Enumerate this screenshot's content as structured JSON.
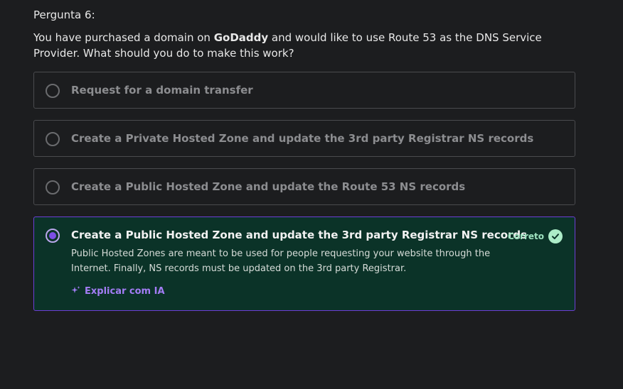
{
  "question": {
    "label": "Pergunta 6:",
    "text_before": "You have purchased a domain on ",
    "text_bold": "GoDaddy",
    "text_after": " and would like to use Route 53 as the DNS Service Provider. What should you do to make this work?"
  },
  "options": [
    {
      "label": "Request for a domain transfer",
      "selected": false
    },
    {
      "label": "Create a Private Hosted Zone and update the 3rd party Registrar NS records",
      "selected": false
    },
    {
      "label": "Create a Public Hosted Zone and update the Route 53 NS records",
      "selected": false
    },
    {
      "label": "Create a Public Hosted Zone and update the 3rd party Registrar NS records",
      "selected": true
    }
  ],
  "feedback": {
    "status": "Correto",
    "explanation": "Public Hosted Zones are meant to be used for people requesting your website through the Internet. Finally, NS records must be updated on the 3rd party Registrar.",
    "ai_link": "Explicar com IA"
  },
  "colors": {
    "background": "#1c1d1f",
    "correct_background": "#0b3328",
    "selected_border": "#6c3fd6",
    "accent_purple": "#a37df5",
    "correct_green": "#acecc8"
  },
  "icons": {
    "status": "check-circle-icon",
    "ai": "sparkle-icon"
  }
}
